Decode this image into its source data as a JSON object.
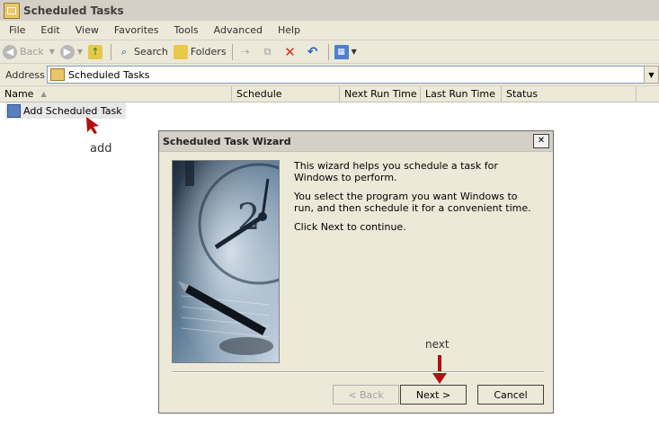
{
  "window": {
    "title": "Scheduled Tasks"
  },
  "menu": [
    "File",
    "Edit",
    "View",
    "Favorites",
    "Tools",
    "Advanced",
    "Help"
  ],
  "toolbar": {
    "back": "Back",
    "search": "Search",
    "folders": "Folders"
  },
  "address": {
    "label": "Address",
    "value": "Scheduled Tasks"
  },
  "columns": [
    "Name",
    "Schedule",
    "Next Run Time",
    "Last Run Time",
    "Status"
  ],
  "list": {
    "items": [
      {
        "label": "Add Scheduled Task"
      }
    ]
  },
  "annotations": {
    "add": "add",
    "next": "next"
  },
  "dialog": {
    "title": "Scheduled Task Wizard",
    "para1": "This wizard helps you schedule a task for Windows to perform.",
    "para2": "You select the program you want Windows to run, and then schedule it for a convenient time.",
    "para3": "Click Next to continue.",
    "back_label": "< Back",
    "next_label": "Next >",
    "cancel_label": "Cancel"
  },
  "colors": {
    "annotation_arrow": "#b01010",
    "wizard_image": "#3d5873"
  }
}
